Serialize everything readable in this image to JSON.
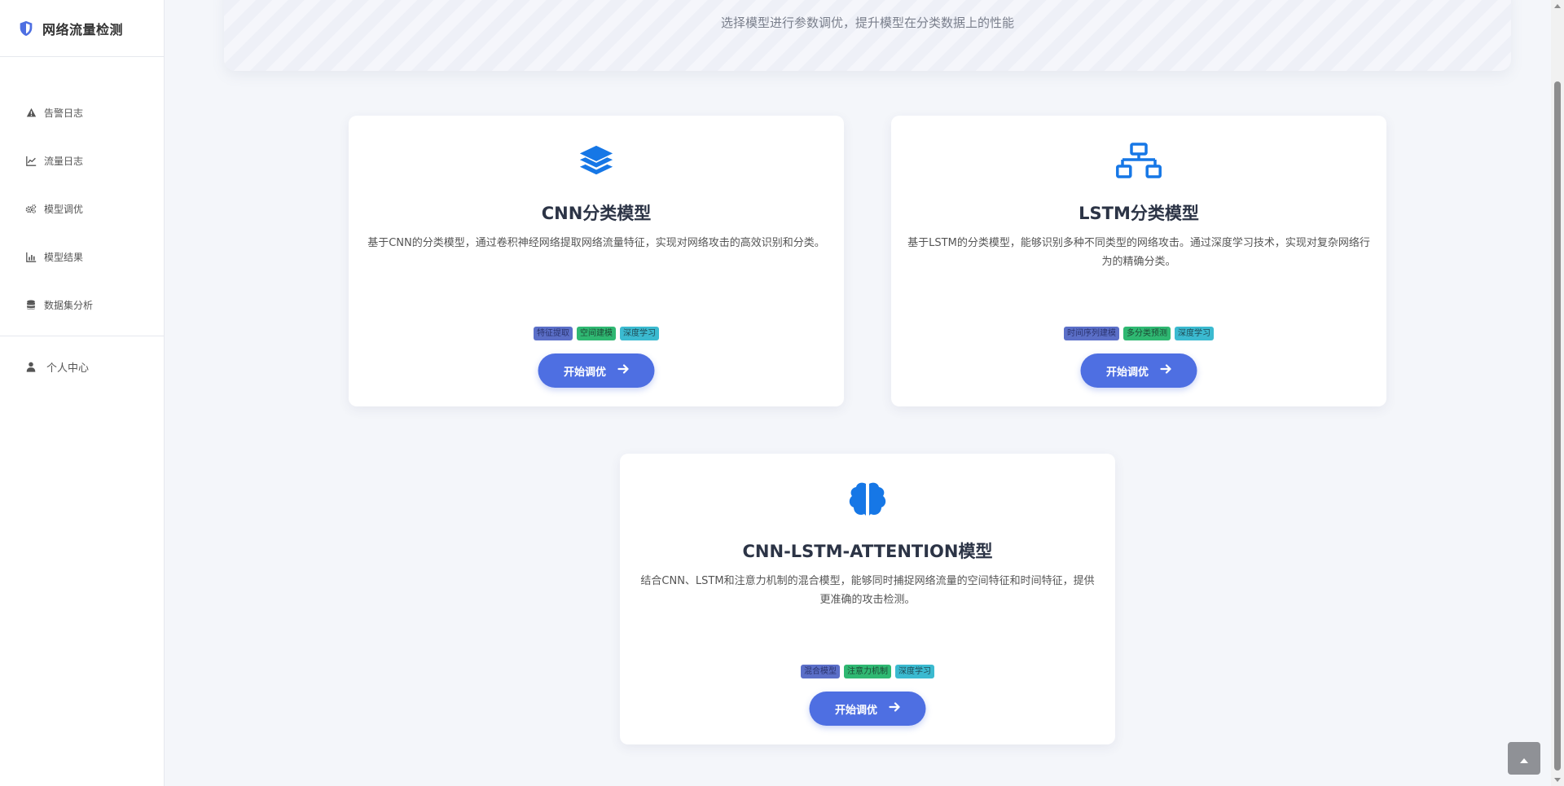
{
  "sidebar": {
    "brand": "网络流量检测",
    "items": [
      {
        "label": "告警日志",
        "icon": "warning-icon"
      },
      {
        "label": "流量日志",
        "icon": "line-chart-icon"
      },
      {
        "label": "模型调优",
        "icon": "cogs-icon"
      },
      {
        "label": "模型结果",
        "icon": "bar-chart-icon"
      },
      {
        "label": "数据集分析",
        "icon": "database-icon"
      }
    ],
    "user": {
      "label": "个人中心",
      "icon": "user-icon"
    }
  },
  "banner": {
    "subtitle": "选择模型进行参数调优，提升模型在分类数据上的性能"
  },
  "cards": [
    {
      "title": "CNN分类模型",
      "desc": "基于CNN的分类模型，通过卷积神经网络提取网络流量特征，实现对网络攻击的高效识别和分类。",
      "tags": [
        "特征提取",
        "空间建模",
        "深度学习"
      ],
      "button": "开始调优",
      "icon": "layers-icon"
    },
    {
      "title": "LSTM分类模型",
      "desc": "基于LSTM的分类模型，能够识别多种不同类型的网络攻击。通过深度学习技术，实现对复杂网络行为的精确分类。",
      "tags": [
        "时间序列建模",
        "多分类预测",
        "深度学习"
      ],
      "button": "开始调优",
      "icon": "network-icon"
    },
    {
      "title": "CNN-LSTM-ATTENTION模型",
      "desc": "结合CNN、LSTM和注意力机制的混合模型，能够同时捕捉网络流量的空间特征和时间特征，提供更准确的攻击检测。",
      "tags": [
        "混合模型",
        "注意力机制",
        "深度学习"
      ],
      "button": "开始调优",
      "icon": "brain-icon"
    }
  ],
  "colors": {
    "accent": "#4e6fe2",
    "icon_blue": "#1677e6"
  }
}
